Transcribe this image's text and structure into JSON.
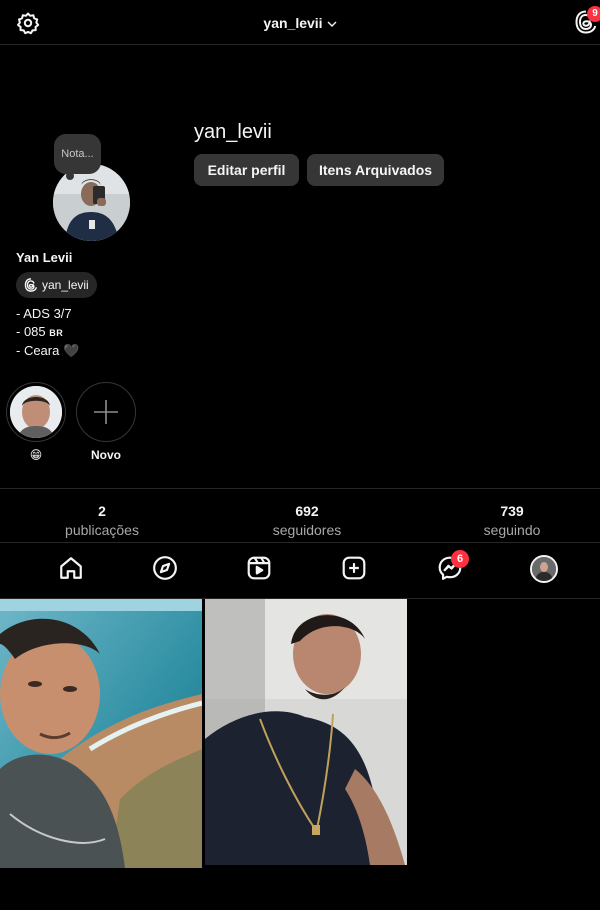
{
  "header": {
    "username": "yan_levii",
    "threads_badge": "9"
  },
  "profile": {
    "note_placeholder": "Nota...",
    "username": "yan_levii",
    "edit_button": "Editar perfil",
    "archive_button": "Itens Arquivados",
    "display_name": "Yan Levii",
    "threads_handle": "yan_levii",
    "bio": {
      "line1": "- ADS 3/7",
      "line2_prefix": "- 085",
      "line2_flag": "BR",
      "line3_prefix": "- Ceara",
      "line3_emoji": "🖤"
    }
  },
  "highlights": [
    {
      "label": "😁"
    },
    {
      "label": "Novo"
    }
  ],
  "stats": {
    "posts": {
      "value": "2",
      "label": "publicações"
    },
    "followers": {
      "value": "692",
      "label": "seguidores"
    },
    "following": {
      "value": "739",
      "label": "seguindo"
    }
  },
  "nav": {
    "messages_badge": "6"
  },
  "colors": {
    "background": "#000000",
    "button": "#363636",
    "badge": "#ff3040",
    "secondary_text": "#a8a8a8"
  },
  "icons": [
    "settings-icon",
    "chevron-down-icon",
    "threads-icon",
    "home-icon",
    "explore-icon",
    "reels-icon",
    "create-icon",
    "messenger-icon",
    "plus-icon"
  ]
}
